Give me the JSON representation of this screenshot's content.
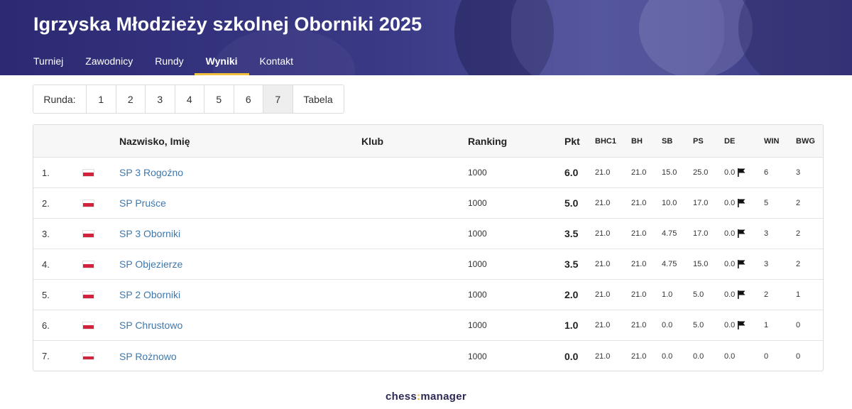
{
  "header": {
    "title": "Igrzyska Młodzieży szkolnej Oborniki 2025",
    "nav": [
      {
        "label": "Turniej",
        "active": false
      },
      {
        "label": "Zawodnicy",
        "active": false
      },
      {
        "label": "Rundy",
        "active": false
      },
      {
        "label": "Wyniki",
        "active": true
      },
      {
        "label": "Kontakt",
        "active": false
      }
    ]
  },
  "rounds": {
    "label": "Runda:",
    "items": [
      "1",
      "2",
      "3",
      "4",
      "5",
      "6",
      "7"
    ],
    "active": "7",
    "tabela_label": "Tabela"
  },
  "table": {
    "headers": {
      "name": "Nazwisko, Imię",
      "club": "Klub",
      "ranking": "Ranking",
      "pkt": "Pkt",
      "bhc1": "BHC1",
      "bh": "BH",
      "sb": "SB",
      "ps": "PS",
      "de": "DE",
      "win": "WIN",
      "bwg": "BWG"
    },
    "rows": [
      {
        "pos": "1.",
        "flag": "pl-flag",
        "name": "SP 3 Rogoźno",
        "club": "",
        "ranking": "1000",
        "pkt": "6.0",
        "bhc1": "21.0",
        "bh": "21.0",
        "sb": "15.0",
        "ps": "25.0",
        "de": "0.0",
        "de_flag": true,
        "win": "6",
        "bwg": "3"
      },
      {
        "pos": "2.",
        "flag": "pl-flag",
        "name": "SP Pruśce",
        "club": "",
        "ranking": "1000",
        "pkt": "5.0",
        "bhc1": "21.0",
        "bh": "21.0",
        "sb": "10.0",
        "ps": "17.0",
        "de": "0.0",
        "de_flag": true,
        "win": "5",
        "bwg": "2"
      },
      {
        "pos": "3.",
        "flag": "pl-flag",
        "name": "SP 3 Oborniki",
        "club": "",
        "ranking": "1000",
        "pkt": "3.5",
        "bhc1": "21.0",
        "bh": "21.0",
        "sb": "4.75",
        "ps": "17.0",
        "de": "0.0",
        "de_flag": true,
        "win": "3",
        "bwg": "2"
      },
      {
        "pos": "4.",
        "flag": "pl-flag",
        "name": "SP Objezierze",
        "club": "",
        "ranking": "1000",
        "pkt": "3.5",
        "bhc1": "21.0",
        "bh": "21.0",
        "sb": "4.75",
        "ps": "15.0",
        "de": "0.0",
        "de_flag": true,
        "win": "3",
        "bwg": "2"
      },
      {
        "pos": "5.",
        "flag": "pl-flag",
        "name": "SP 2 Oborniki",
        "club": "",
        "ranking": "1000",
        "pkt": "2.0",
        "bhc1": "21.0",
        "bh": "21.0",
        "sb": "1.0",
        "ps": "5.0",
        "de": "0.0",
        "de_flag": true,
        "win": "2",
        "bwg": "1"
      },
      {
        "pos": "6.",
        "flag": "pl-flag",
        "name": "SP Chrustowo",
        "club": "",
        "ranking": "1000",
        "pkt": "1.0",
        "bhc1": "21.0",
        "bh": "21.0",
        "sb": "0.0",
        "ps": "5.0",
        "de": "0.0",
        "de_flag": true,
        "win": "1",
        "bwg": "0"
      },
      {
        "pos": "7.",
        "flag": "pl-flag",
        "name": "SP Rożnowo",
        "club": "",
        "ranking": "1000",
        "pkt": "0.0",
        "bhc1": "21.0",
        "bh": "21.0",
        "sb": "0.0",
        "ps": "0.0",
        "de": "0.0",
        "de_flag": false,
        "win": "0",
        "bwg": "0"
      }
    ]
  },
  "footer": {
    "logo_left": "chess",
    "logo_sep": ":",
    "logo_right": "manager"
  },
  "colors": {
    "header_bg": "#2c2a72",
    "active_underline": "#f0c040",
    "link": "#3f78ad",
    "pl_red": "#d4213d"
  }
}
